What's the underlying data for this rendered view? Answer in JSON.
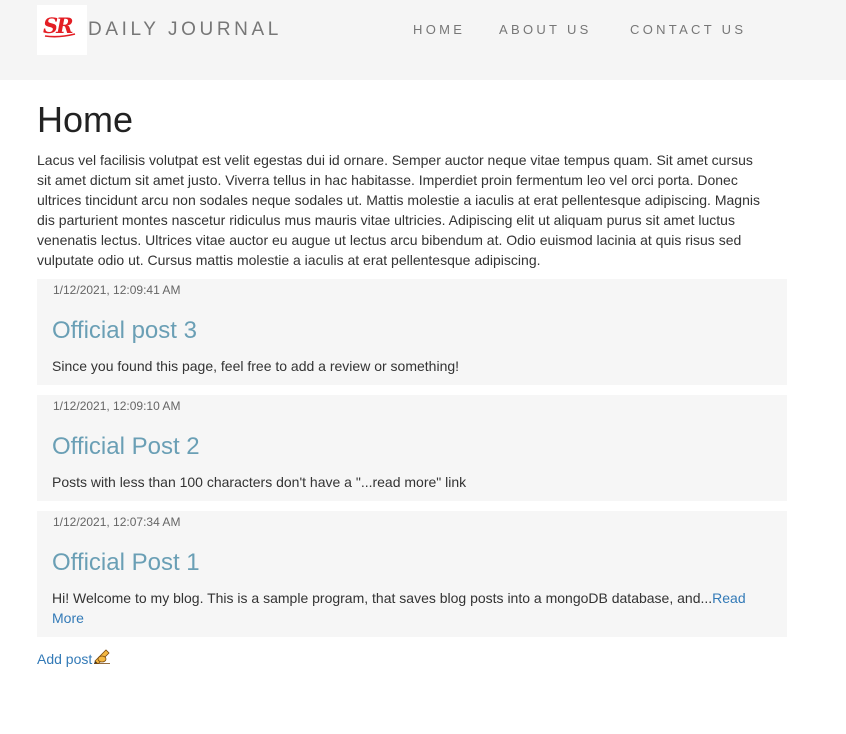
{
  "brand": {
    "logo_text": "SR",
    "name": "DAILY JOURNAL"
  },
  "nav": {
    "items": [
      {
        "label": "HOME"
      },
      {
        "label": "ABOUT US"
      },
      {
        "label": "CONTACT US"
      }
    ]
  },
  "page": {
    "title": "Home",
    "intro": "Lacus vel facilisis volutpat est velit egestas dui id ornare. Semper auctor neque vitae tempus quam. Sit amet cursus sit amet dictum sit amet justo. Viverra tellus in hac habitasse. Imperdiet proin fermentum leo vel orci porta. Donec ultrices tincidunt arcu non sodales neque sodales ut. Mattis molestie a iaculis at erat pellentesque adipiscing. Magnis dis parturient montes nascetur ridiculus mus mauris vitae ultricies. Adipiscing elit ut aliquam purus sit amet luctus venenatis lectus. Ultrices vitae auctor eu augue ut lectus arcu bibendum at. Odio euismod lacinia at quis risus sed vulputate odio ut. Cursus mattis molestie a iaculis at erat pellentesque adipiscing."
  },
  "posts": [
    {
      "date": "1/12/2021, 12:09:41 AM",
      "title": "Official post 3",
      "body": "Since you found this page, feel free to add a review or something!"
    },
    {
      "date": "1/12/2021, 12:09:10 AM",
      "title": "Official Post 2",
      "body": "Posts with less than 100 characters don't have a \"...read more\" link"
    },
    {
      "date": "1/12/2021, 12:07:34 AM",
      "title": "Official Post 1",
      "body": "Hi! Welcome to my blog. This is a sample program, that saves blog posts into a mongoDB database, and...",
      "read_more": "Read More"
    }
  ],
  "add_post": {
    "label": "Add post",
    "icon": "writing-hand-icon"
  },
  "colors": {
    "navbar_bg": "#f5f5f5",
    "post_bg": "#f6f6f6",
    "post_title": "#6a9fb5",
    "link": "#337ab7",
    "logo_red": "#e31e24"
  }
}
